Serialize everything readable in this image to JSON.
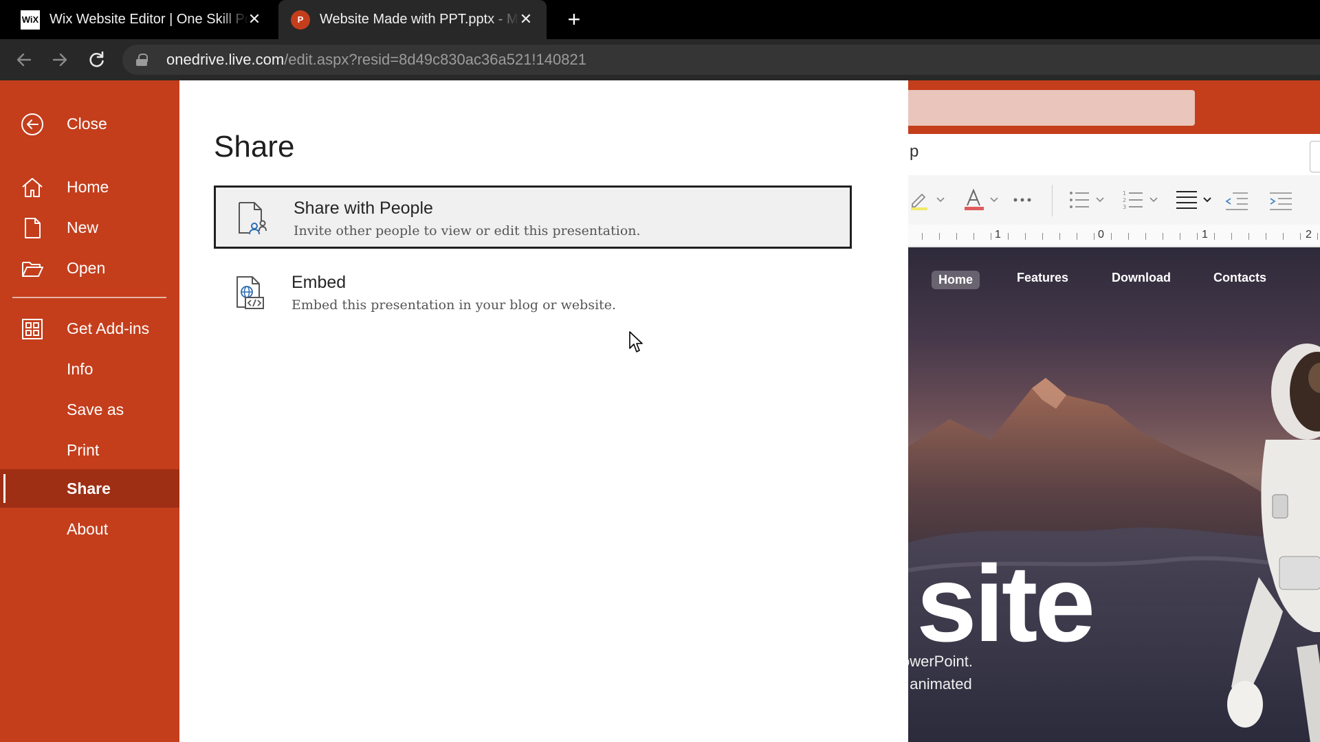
{
  "browser": {
    "tabs": [
      {
        "title": "Wix Website Editor | One Skill Po",
        "favicon": "WiX",
        "active": false
      },
      {
        "title": "Website Made with PPT.pptx - M",
        "favicon": "P",
        "active": true
      }
    ],
    "url_host": "onedrive.live.com",
    "url_path": "/edit.aspx?resid=8d49c830ac36a521!140821"
  },
  "sidebar": {
    "items": [
      {
        "label": "Close",
        "icon": "back-arrow-icon"
      },
      {
        "label": "Home",
        "icon": "home-icon"
      },
      {
        "label": "New",
        "icon": "new-document-icon"
      },
      {
        "label": "Open",
        "icon": "folder-open-icon"
      },
      {
        "label": "Get Add-ins",
        "icon": "add-ins-icon"
      },
      {
        "label": "Info"
      },
      {
        "label": "Save as"
      },
      {
        "label": "Print"
      },
      {
        "label": "Share",
        "selected": true
      },
      {
        "label": "About"
      }
    ]
  },
  "share_panel": {
    "title": "Share",
    "options": [
      {
        "title": "Share with People",
        "description": "Invite other people to view or edit this presentation.",
        "icon": "share-people-icon",
        "selected": true
      },
      {
        "title": "Embed",
        "description": "Embed this presentation in your blog or website.",
        "icon": "embed-icon"
      }
    ]
  },
  "editor": {
    "tab_fragment": "p",
    "ruler_numbers": [
      "1",
      "0",
      "1",
      "2"
    ],
    "slide": {
      "nav": [
        "Home",
        "Features",
        "Download",
        "Contacts"
      ],
      "headline_fragment": "site",
      "subtext_line1": "owerPoint.",
      "subtext_line2": ", animated"
    }
  },
  "colors": {
    "powerpoint_red": "#c43e1c",
    "selected_sidebar": "#9e2f14",
    "browser_chrome": "#282828"
  }
}
